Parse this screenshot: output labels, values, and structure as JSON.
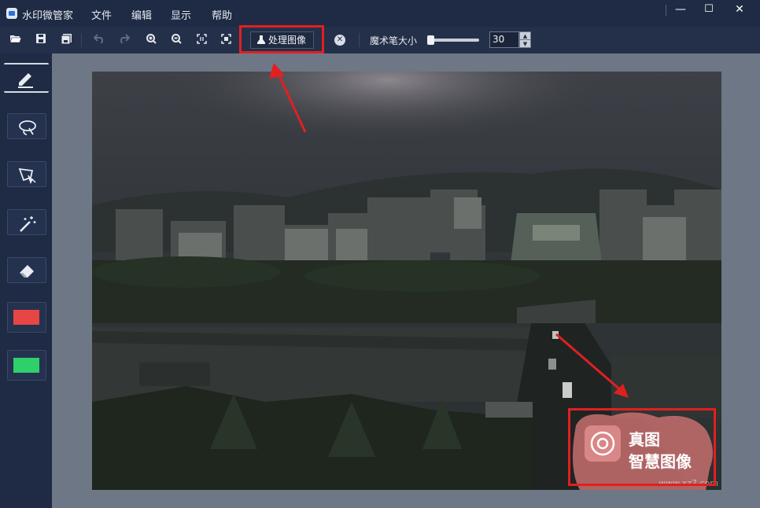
{
  "titlebar": {
    "app_title": "水印微管家",
    "menu": [
      "文件",
      "编辑",
      "显示",
      "帮助"
    ],
    "window_buttons": {
      "minimize": "—",
      "maximize": "☐",
      "close": "✕"
    }
  },
  "toolbar": {
    "process_button": "处理图像",
    "brush_size_label": "魔术笔大小",
    "brush_size_value": "30",
    "brush_size_slider_fraction": 0.05
  },
  "sidebar": {
    "tools": [
      "pencil-tool",
      "lasso-tool",
      "polygon-select-tool",
      "magic-wand-tool",
      "eraser-tool"
    ],
    "swatches": {
      "primary": "#e84545",
      "secondary": "#2fcf6a"
    }
  },
  "canvas": {
    "watermark_line1": "真图",
    "watermark_line2": "智慧图像",
    "site_watermark": "www.xz7.com"
  },
  "colors": {
    "annotation": "#e02020"
  }
}
